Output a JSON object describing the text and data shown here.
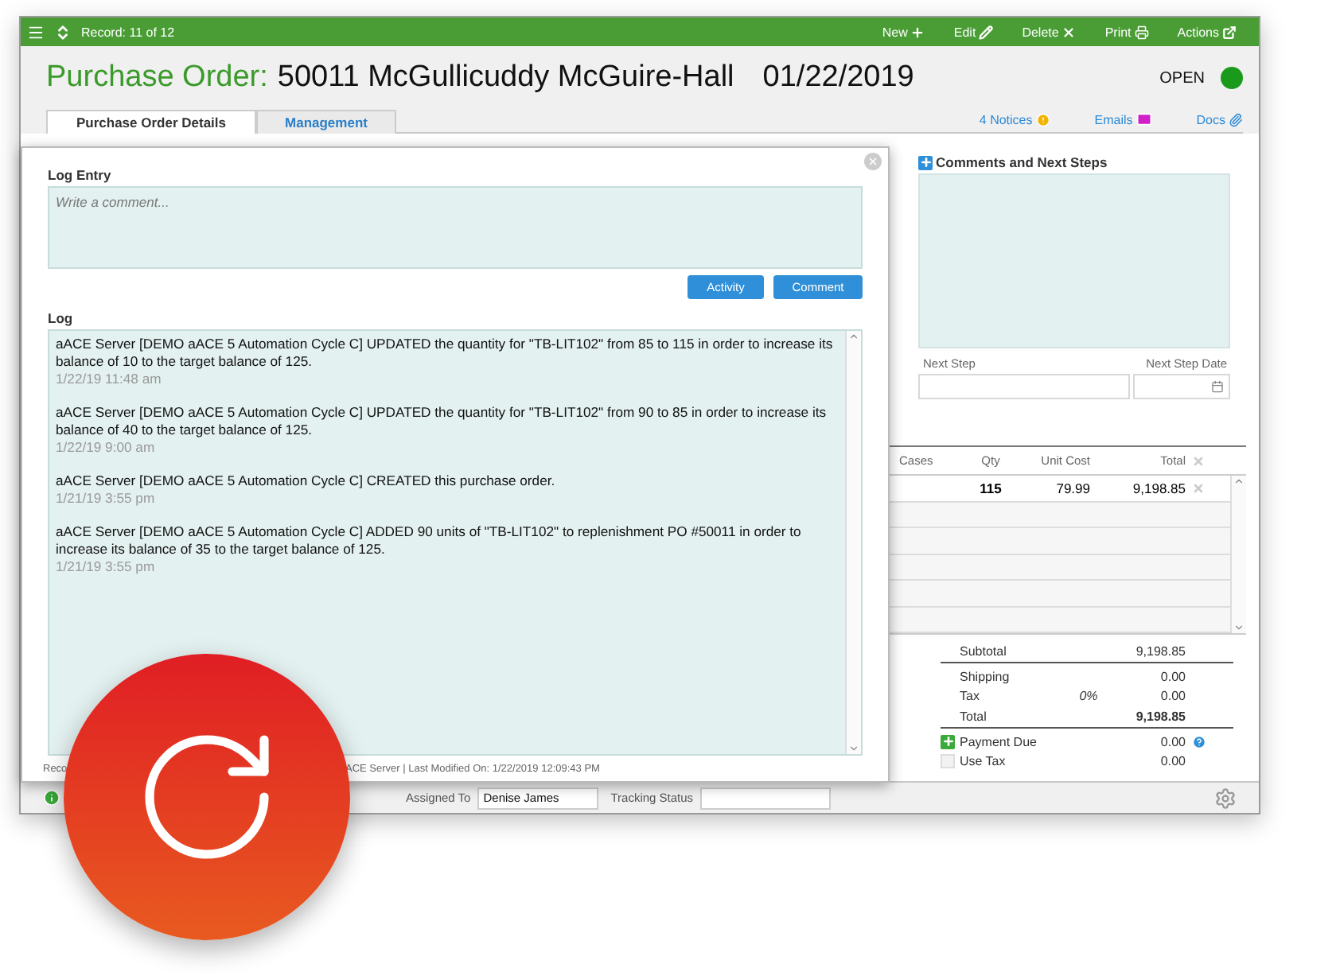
{
  "toolbar": {
    "record": "Record: 11 of 12",
    "actions": [
      {
        "label": "New",
        "kind": "new"
      },
      {
        "label": "Edit",
        "kind": "edit"
      },
      {
        "label": "Delete",
        "kind": "delete"
      },
      {
        "label": "Print",
        "kind": "print"
      },
      {
        "label": "Actions",
        "kind": "actions"
      }
    ]
  },
  "header": {
    "title_label": "Purchase Order:",
    "title": "50011 McGullicuddy McGuire-Hall",
    "date": "01/22/2019",
    "status": "OPEN"
  },
  "tabs": [
    {
      "label": "Purchase Order Details",
      "selected": true
    },
    {
      "label": "Management",
      "selected": false
    }
  ],
  "links": [
    {
      "label": "4 Notices",
      "kind": "notice"
    },
    {
      "label": "Emails",
      "kind": "email"
    },
    {
      "label": "Docs",
      "kind": "docs"
    }
  ],
  "log_dialog": {
    "entry_label": "Log Entry",
    "placeholder": "Write a comment...",
    "buttons": [
      "Activity",
      "Comment"
    ],
    "log_label": "Log",
    "entries": [
      {
        "text": "aACE Server [DEMO aACE 5 Automation Cycle C] UPDATED the quantity for \"TB-LIT102\" from 85 to 115 in order to increase its balance of 10 to the target balance of 125.",
        "time": "1/22/19  11:48 am"
      },
      {
        "text": "aACE Server [DEMO aACE 5 Automation Cycle C] UPDATED the quantity for \"TB-LIT102\" from  90  to 85 in order to increase its balance of 40 to the target balance of 125.",
        "time": "1/22/19  9:00 am"
      },
      {
        "text": "aACE Server [DEMO aACE 5 Automation Cycle C] CREATED this purchase order.",
        "time": "1/21/19  3:55 pm"
      },
      {
        "text": "aACE Server [DEMO aACE 5 Automation Cycle C] ADDED 90 units of \"TB-LIT102\" to replenishment PO #50011 in order to increase its balance of 35 to the target balance of 125.",
        "time": "1/21/19  3:55 pm"
      }
    ],
    "footer_start": "Reco",
    "footer_user": "ACE Server  |  Last Modified On: 1/22/2019 12:09:43 PM"
  },
  "comments": {
    "title": "Comments and Next Steps",
    "next_step_label": "Next Step",
    "next_step_date_label": "Next Step Date"
  },
  "table": {
    "columns": [
      "Cases",
      "Qty",
      "Unit Cost",
      "Total"
    ],
    "rows": [
      {
        "qty": "115",
        "unit_cost": "79.99",
        "total": "9,198.85"
      }
    ]
  },
  "totals": [
    {
      "label": "Subtotal",
      "value": "9,198.85",
      "kind": "sub"
    },
    {
      "label": "Shipping",
      "value": "0.00",
      "kind": "plain"
    },
    {
      "label": "Tax",
      "rate": "0%",
      "value": "0.00",
      "kind": "plain"
    },
    {
      "label": "Total",
      "value": "9,198.85",
      "kind": "grand"
    },
    {
      "label": "Payment Due",
      "value": "0.00",
      "kind": "add"
    },
    {
      "label": "Use Tax",
      "value": "0.00",
      "kind": "checkbox",
      "checked": false
    }
  ],
  "bottom": {
    "assigned_label": "Assigned To",
    "assigned_value": "Denise James",
    "tracking_label": "Tracking Status"
  }
}
